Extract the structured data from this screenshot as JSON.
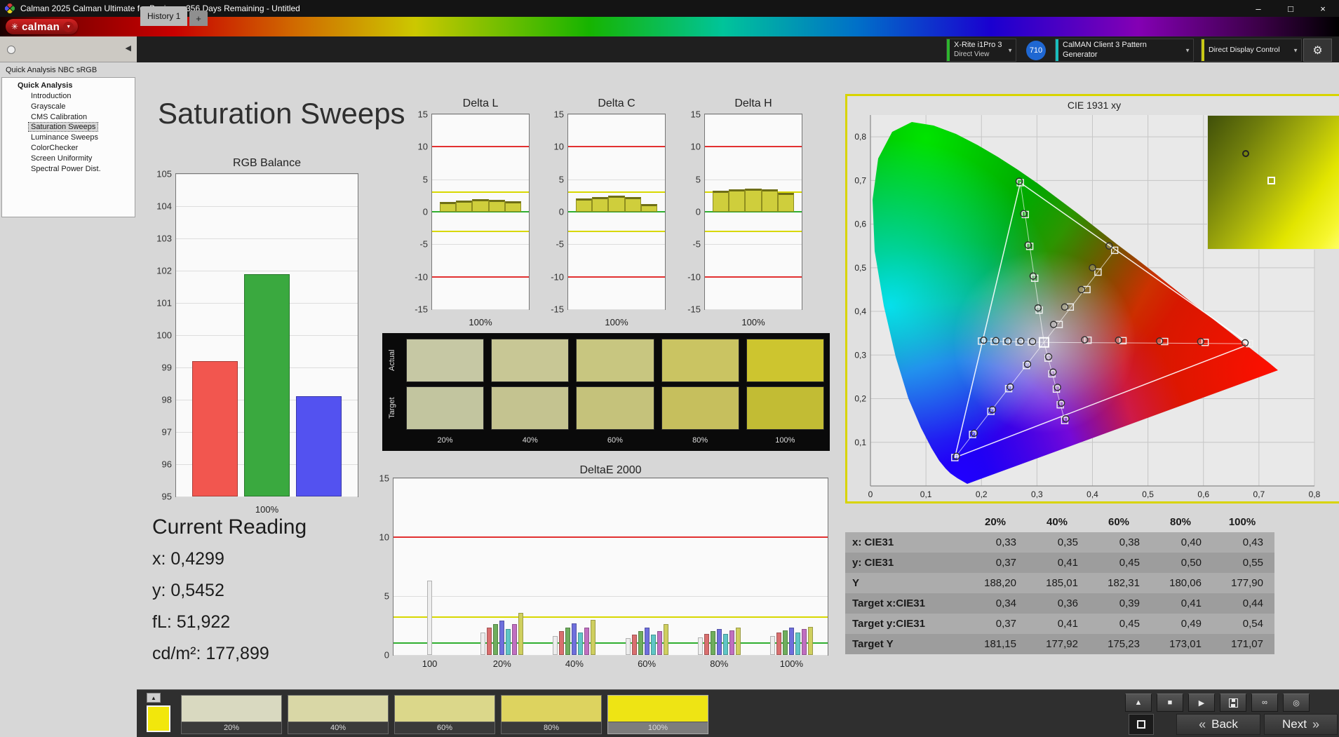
{
  "window": {
    "title": "Calman 2025 Calman Ultimate for Business 356 Days Remaining  - Untitled",
    "minimize": "–",
    "maximize": "□",
    "close": "×"
  },
  "brand": {
    "logo": "calman",
    "dropdown_glyph": "▼"
  },
  "tab_bar": {
    "tabs": [
      {
        "label": "History 1",
        "active": true
      }
    ],
    "add_tab": "+"
  },
  "toolbar": {
    "meter": {
      "line1": "X-Rite i1Pro 3",
      "line2": "Direct View",
      "accent": "#2db52d"
    },
    "badge": {
      "text": "710",
      "color": "#1f67d2"
    },
    "pattern_generator": {
      "label": "CalMAN Client 3 Pattern Generator",
      "accent": "#19bdbd"
    },
    "display_control": {
      "label": "Direct Display Control",
      "accent": "#c9c915"
    },
    "settings_glyph": "⚙",
    "dropdown_glyph": "▼",
    "collapse_glyph": "◀"
  },
  "sidebar": {
    "header": "Quick Analysis NBC sRGB",
    "tree": {
      "root": "Quick Analysis",
      "items": [
        "Introduction",
        "Grayscale",
        "CMS Calibration",
        "Saturation Sweeps",
        "Luminance Sweeps",
        "ColorChecker",
        "Screen Uniformity",
        "Spectral Power Dist."
      ],
      "selected": "Saturation Sweeps"
    }
  },
  "page": {
    "title": "Saturation Sweeps"
  },
  "current_reading": {
    "title": "Current Reading",
    "lines": [
      "x: 0,4299",
      "y: 0,5452",
      "fL: 51,922",
      "cd/m²: 177,899"
    ]
  },
  "chart_data": [
    {
      "id": "rgb_balance",
      "type": "bar",
      "title": "RGB Balance",
      "xlabel": "100%",
      "categories": [
        "Red",
        "Green",
        "Blue"
      ],
      "values": [
        99.2,
        101.9,
        98.1
      ],
      "colors": [
        "#f2564f",
        "#3aa93f",
        "#5352f0"
      ],
      "ylim": [
        95,
        105
      ],
      "yticks": [
        105,
        104,
        103,
        102,
        101,
        100,
        99,
        98,
        97,
        96,
        95
      ]
    },
    {
      "id": "delta_l",
      "type": "bar",
      "title": "Delta L",
      "xlabel": "100%",
      "values": [
        1.5,
        1.7,
        1.9,
        1.8,
        1.6
      ],
      "bar_color": "#cfce3c",
      "ylim": [
        -15,
        15
      ],
      "yticks": [
        15,
        10,
        5,
        0,
        -5,
        -10,
        -15
      ],
      "ref_lines": [
        {
          "y": 10,
          "color": "#e23030"
        },
        {
          "y": -10,
          "color": "#e23030"
        },
        {
          "y": 3,
          "color": "#d8d800"
        },
        {
          "y": -3,
          "color": "#d8d800"
        },
        {
          "y": 0,
          "color": "#2faf2f"
        }
      ]
    },
    {
      "id": "delta_c",
      "type": "bar",
      "title": "Delta C",
      "xlabel": "100%",
      "values": [
        2.1,
        2.3,
        2.5,
        2.3,
        1.2
      ],
      "bar_color": "#cfce3c",
      "ylim": [
        -15,
        15
      ],
      "yticks": [
        15,
        10,
        5,
        0,
        -5,
        -10,
        -15
      ],
      "ref_lines": [
        {
          "y": 10,
          "color": "#e23030"
        },
        {
          "y": -10,
          "color": "#e23030"
        },
        {
          "y": 3,
          "color": "#d8d800"
        },
        {
          "y": -3,
          "color": "#d8d800"
        },
        {
          "y": 0,
          "color": "#2faf2f"
        }
      ]
    },
    {
      "id": "delta_h",
      "type": "bar",
      "title": "Delta H",
      "xlabel": "100%",
      "values": [
        3.2,
        3.5,
        3.6,
        3.4,
        2.9
      ],
      "bar_color": "#cfce3c",
      "ylim": [
        -15,
        15
      ],
      "yticks": [
        15,
        10,
        5,
        0,
        -5,
        -10,
        -15
      ],
      "ref_lines": [
        {
          "y": 10,
          "color": "#e23030"
        },
        {
          "y": -10,
          "color": "#e23030"
        },
        {
          "y": 3,
          "color": "#d8d800"
        },
        {
          "y": -3,
          "color": "#d8d800"
        },
        {
          "y": 0,
          "color": "#2faf2f"
        }
      ]
    },
    {
      "id": "deltae2000",
      "type": "grouped-bar",
      "title": "DeltaE 2000",
      "ylim": [
        0,
        15
      ],
      "yticks": [
        15,
        10,
        5,
        0
      ],
      "categories": [
        "100",
        "20%",
        "40%",
        "60%",
        "80%",
        "100%"
      ],
      "bar_colors": [
        "#ededed",
        "#d96f6f",
        "#6fae5d",
        "#6f6fdd",
        "#5fc6c6",
        "#c06fc0",
        "#cfcf5f"
      ],
      "groups": [
        [
          6.3
        ],
        [
          1.9,
          2.3,
          2.6,
          2.9,
          2.2,
          2.6,
          3.6
        ],
        [
          1.6,
          2.0,
          2.3,
          2.7,
          1.9,
          2.3,
          3.0
        ],
        [
          1.4,
          1.7,
          2.0,
          2.3,
          1.7,
          2.0,
          2.6
        ],
        [
          1.5,
          1.8,
          2.0,
          2.2,
          1.8,
          2.1,
          2.3
        ],
        [
          1.6,
          1.9,
          2.1,
          2.3,
          1.9,
          2.2,
          2.4
        ]
      ],
      "ref_lines": [
        {
          "y": 10,
          "color": "#e23030"
        },
        {
          "y": 3.2,
          "color": "#d8d800"
        },
        {
          "y": 1,
          "color": "#2faf2f"
        }
      ]
    },
    {
      "id": "cie",
      "type": "scatter",
      "title": "CIE 1931 xy",
      "xlim": [
        0,
        0.8
      ],
      "ylim": [
        0,
        0.85
      ],
      "xticks": [
        "0",
        "0,1",
        "0,2",
        "0,3",
        "0,4",
        "0,5",
        "0,6",
        "0,7",
        "0,8"
      ],
      "yticks": [
        "0,1",
        "0,2",
        "0,3",
        "0,4",
        "0,5",
        "0,6",
        "0,7",
        "0,8"
      ],
      "white_point": [
        0.3127,
        0.329
      ],
      "gamut_triangle": [
        [
          0.27,
          0.695
        ],
        [
          0.683,
          0.325
        ],
        [
          0.152,
          0.065
        ]
      ],
      "sweeps": [
        {
          "name": "yellow",
          "targets": [
            [
              0.34,
              0.37
            ],
            [
              0.36,
              0.41
            ],
            [
              0.39,
              0.45
            ],
            [
              0.41,
              0.49
            ],
            [
              0.44,
              0.54
            ]
          ],
          "measured": [
            [
              0.33,
              0.37
            ],
            [
              0.35,
              0.41
            ],
            [
              0.38,
              0.45
            ],
            [
              0.4,
              0.5
            ],
            [
              0.43,
              0.55
            ]
          ]
        },
        {
          "name": "red",
          "targets": [
            [
              0.392,
              0.334
            ],
            [
              0.455,
              0.333
            ],
            [
              0.53,
              0.331
            ],
            [
              0.603,
              0.329
            ],
            [
              0.683,
              0.326
            ]
          ],
          "measured": [
            [
              0.386,
              0.335
            ],
            [
              0.447,
              0.334
            ],
            [
              0.521,
              0.332
            ],
            [
              0.595,
              0.331
            ],
            [
              0.675,
              0.328
            ]
          ]
        },
        {
          "name": "green",
          "targets": [
            [
              0.304,
              0.403
            ],
            [
              0.296,
              0.476
            ],
            [
              0.287,
              0.549
            ],
            [
              0.279,
              0.622
            ],
            [
              0.27,
              0.695
            ]
          ],
          "measured": [
            [
              0.302,
              0.408
            ],
            [
              0.293,
              0.481
            ],
            [
              0.284,
              0.552
            ],
            [
              0.276,
              0.624
            ],
            [
              0.268,
              0.698
            ]
          ]
        },
        {
          "name": "blue",
          "targets": [
            [
              0.281,
              0.276
            ],
            [
              0.249,
              0.223
            ],
            [
              0.217,
              0.171
            ],
            [
              0.184,
              0.118
            ],
            [
              0.152,
              0.065
            ]
          ],
          "measured": [
            [
              0.283,
              0.279
            ],
            [
              0.252,
              0.227
            ],
            [
              0.22,
              0.175
            ],
            [
              0.187,
              0.121
            ],
            [
              0.155,
              0.068
            ]
          ]
        },
        {
          "name": "cyan",
          "targets": [
            [
              0.29,
              0.33
            ],
            [
              0.268,
              0.33
            ],
            [
              0.245,
              0.331
            ],
            [
              0.223,
              0.331
            ],
            [
              0.2,
              0.332
            ]
          ],
          "measured": [
            [
              0.292,
              0.331
            ],
            [
              0.271,
              0.332
            ],
            [
              0.248,
              0.332
            ],
            [
              0.226,
              0.333
            ],
            [
              0.204,
              0.334
            ]
          ]
        },
        {
          "name": "magenta",
          "targets": [
            [
              0.32,
              0.293
            ],
            [
              0.327,
              0.257
            ],
            [
              0.335,
              0.222
            ],
            [
              0.342,
              0.186
            ],
            [
              0.35,
              0.15
            ]
          ],
          "measured": [
            [
              0.321,
              0.296
            ],
            [
              0.329,
              0.261
            ],
            [
              0.337,
              0.226
            ],
            [
              0.344,
              0.19
            ],
            [
              0.352,
              0.154
            ]
          ]
        }
      ]
    }
  ],
  "swatch_panel": {
    "rows": [
      {
        "label": "Actual",
        "colors": [
          "#c6c8a4",
          "#c8c795",
          "#c8c680",
          "#cac462",
          "#cdc52f"
        ]
      },
      {
        "label": "Target",
        "colors": [
          "#c2c59f",
          "#c4c390",
          "#c5c27b",
          "#c6bf5d",
          "#c2bc34"
        ]
      }
    ],
    "col_labels": [
      "20%",
      "40%",
      "60%",
      "80%",
      "100%"
    ]
  },
  "table": {
    "header": [
      "20%",
      "40%",
      "60%",
      "80%",
      "100%"
    ],
    "rows": [
      {
        "label": "x: CIE31",
        "values": [
          "0,33",
          "0,35",
          "0,38",
          "0,40",
          "0,43"
        ]
      },
      {
        "label": "y: CIE31",
        "values": [
          "0,37",
          "0,41",
          "0,45",
          "0,50",
          "0,55"
        ]
      },
      {
        "label": "Y",
        "values": [
          "188,20",
          "185,01",
          "182,31",
          "180,06",
          "177,90"
        ]
      },
      {
        "label": "Target x:CIE31",
        "values": [
          "0,34",
          "0,36",
          "0,39",
          "0,41",
          "0,44"
        ]
      },
      {
        "label": "Target y:CIE31",
        "values": [
          "0,37",
          "0,41",
          "0,45",
          "0,49",
          "0,54"
        ]
      },
      {
        "label": "Target Y",
        "values": [
          "181,15",
          "177,92",
          "175,23",
          "173,01",
          "171,07"
        ]
      }
    ]
  },
  "bottom_bar": {
    "collapse_glyph": "▲",
    "preview_color": "#f2e70c",
    "pattern_swatches": [
      {
        "label": "20%",
        "color": "#d9d9c0"
      },
      {
        "label": "40%",
        "color": "#d9d7a6"
      },
      {
        "label": "60%",
        "color": "#dbd78a"
      },
      {
        "label": "80%",
        "color": "#ddd35f"
      },
      {
        "label": "100%",
        "color": "#eee414",
        "selected": true
      }
    ],
    "transport": [
      {
        "name": "eject",
        "glyph": "▲"
      },
      {
        "name": "stop",
        "glyph": "■"
      },
      {
        "name": "play",
        "glyph": "▶"
      },
      {
        "name": "save",
        "glyph": ""
      },
      {
        "name": "loop",
        "glyph": "∞"
      },
      {
        "name": "snapshot",
        "glyph": "◎"
      }
    ],
    "back": {
      "label": "Back",
      "glyph": "«"
    },
    "next": {
      "label": "Next",
      "glyph": "»"
    }
  }
}
